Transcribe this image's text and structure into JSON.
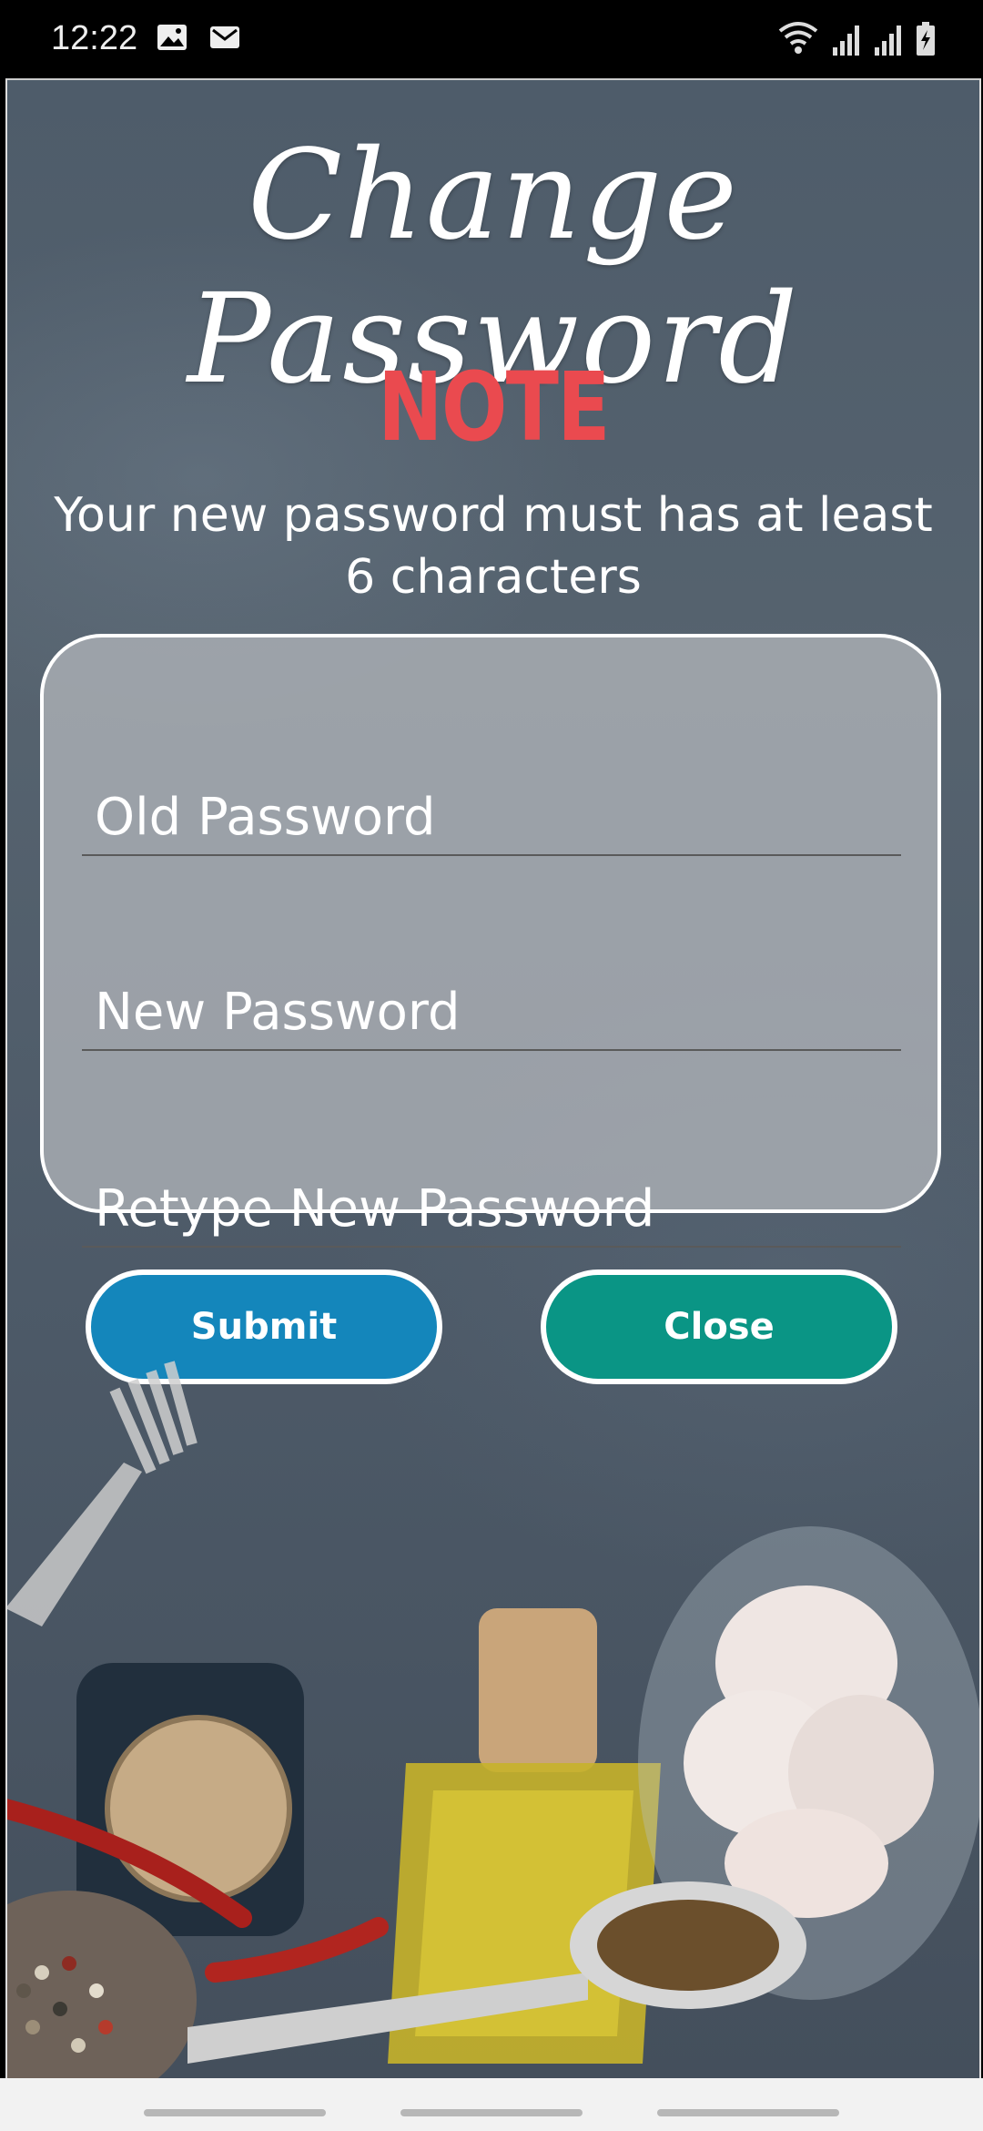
{
  "status_bar": {
    "time": "12:22",
    "left_icons": [
      "image-icon",
      "mail-icon"
    ],
    "right_icons": [
      "wifi-icon",
      "signal-icon",
      "signal-icon-2",
      "battery-icon"
    ]
  },
  "header": {
    "title": "Change Password",
    "note_heading": "NOTE",
    "note_text": "Your new password must has at least 6 characters"
  },
  "form": {
    "old_password_placeholder": "Old Password",
    "new_password_placeholder": "New Password",
    "retype_password_placeholder": "Retype New Password"
  },
  "buttons": {
    "submit_label": "Submit",
    "close_label": "Close"
  },
  "colors": {
    "note": "#ea4a4f",
    "submit": "#1486bb",
    "close": "#0a9585",
    "background": "#4e5c6a"
  }
}
